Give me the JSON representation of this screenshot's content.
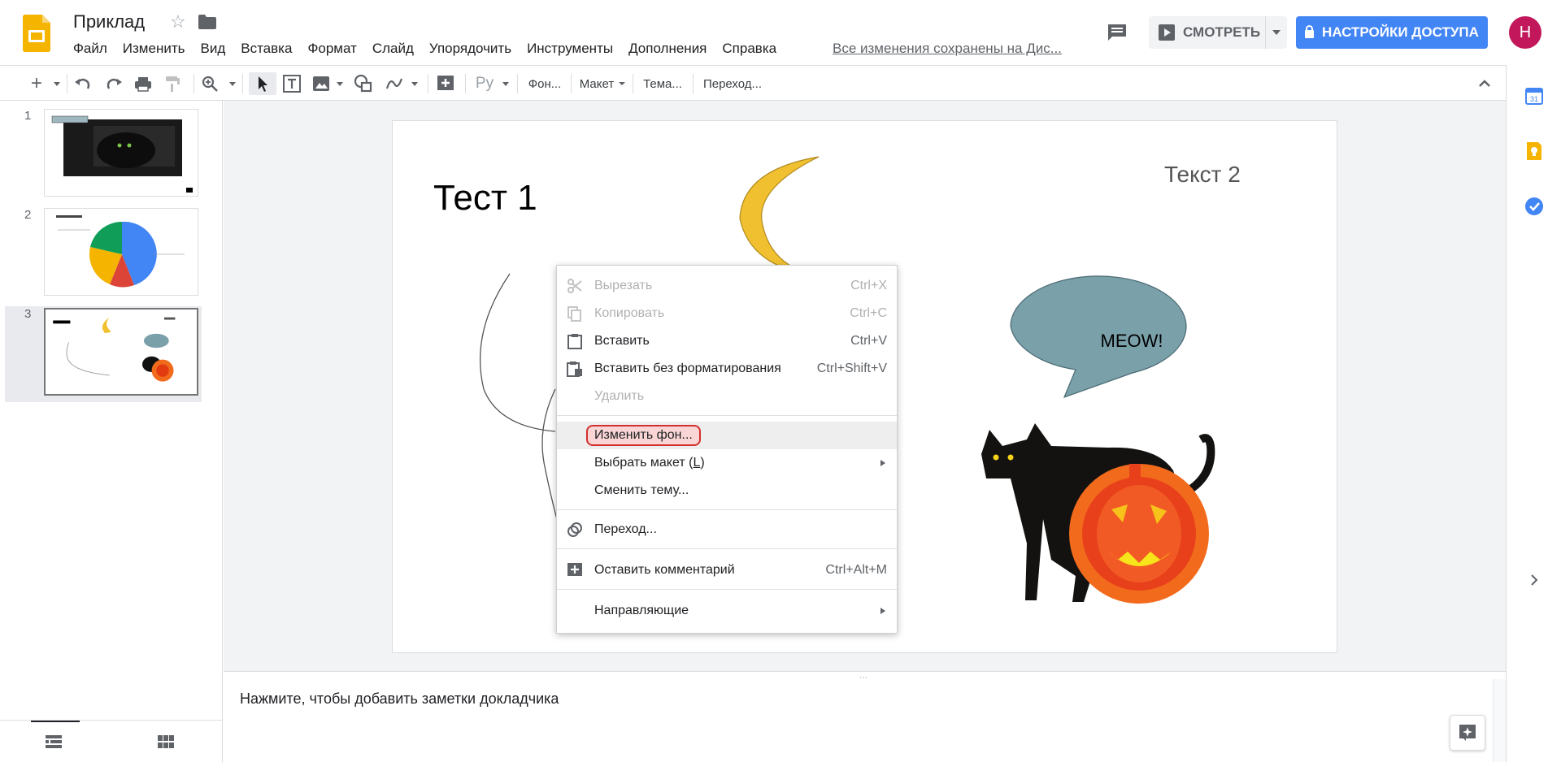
{
  "header": {
    "title": "Приклад",
    "menu": [
      "Файл",
      "Изменить",
      "Вид",
      "Вставка",
      "Формат",
      "Слайд",
      "Упорядочить",
      "Инструменты",
      "Дополнения",
      "Справка"
    ],
    "saved_status": "Все изменения сохранены на Дис...",
    "present_label": "СМОТРЕТЬ",
    "share_label": "НАСТРОЙКИ ДОСТУПА",
    "avatar_letter": "Н"
  },
  "toolbar": {
    "font_label": "Ру",
    "background_label": "Фон...",
    "layout_label": "Макет",
    "theme_label": "Тема...",
    "transition_label": "Переход..."
  },
  "filmstrip": {
    "slides": [
      {
        "number": "1"
      },
      {
        "number": "2"
      },
      {
        "number": "3"
      }
    ],
    "selected_index": 3
  },
  "slide": {
    "title_1": "Тест 1",
    "title_2": "Текст 2",
    "bubble_text": "MEOW!"
  },
  "notes": {
    "placeholder": "Нажмите, чтобы добавить заметки докладчика"
  },
  "context_menu": {
    "items": [
      {
        "label": "Вырезать",
        "shortcut": "Ctrl+X",
        "disabled": true,
        "icon": "scissors-icon"
      },
      {
        "label": "Копировать",
        "shortcut": "Ctrl+C",
        "disabled": true,
        "icon": "copy-icon"
      },
      {
        "label": "Вставить",
        "shortcut": "Ctrl+V",
        "disabled": false,
        "icon": "clipboard-icon"
      },
      {
        "label": "Вставить без форматирования",
        "shortcut": "Ctrl+Shift+V",
        "disabled": false,
        "icon": "paste-plain-icon"
      },
      {
        "label": "Удалить",
        "shortcut": "",
        "disabled": true,
        "icon": ""
      },
      {
        "label": "Изменить фон...",
        "shortcut": "",
        "disabled": false,
        "highlighted": true
      },
      {
        "label": "Выбрать макет",
        "shortcut_key": "L",
        "submenu": true
      },
      {
        "label": "Сменить тему...",
        "shortcut": ""
      },
      {
        "label": "Переход...",
        "shortcut": "",
        "icon": "transition-icon"
      },
      {
        "label": "Оставить комментарий",
        "shortcut": "Ctrl+Alt+M",
        "icon": "add-comment-icon"
      },
      {
        "label": "Направляющие",
        "submenu": true
      }
    ]
  },
  "colors": {
    "accent_blue": "#4285f4",
    "avatar_bg": "#c2185b",
    "slides_yellow": "#f4b400",
    "moon": "#f0c030",
    "bubble": "#7aa0aa",
    "highlight_red": "#d32f2f"
  }
}
